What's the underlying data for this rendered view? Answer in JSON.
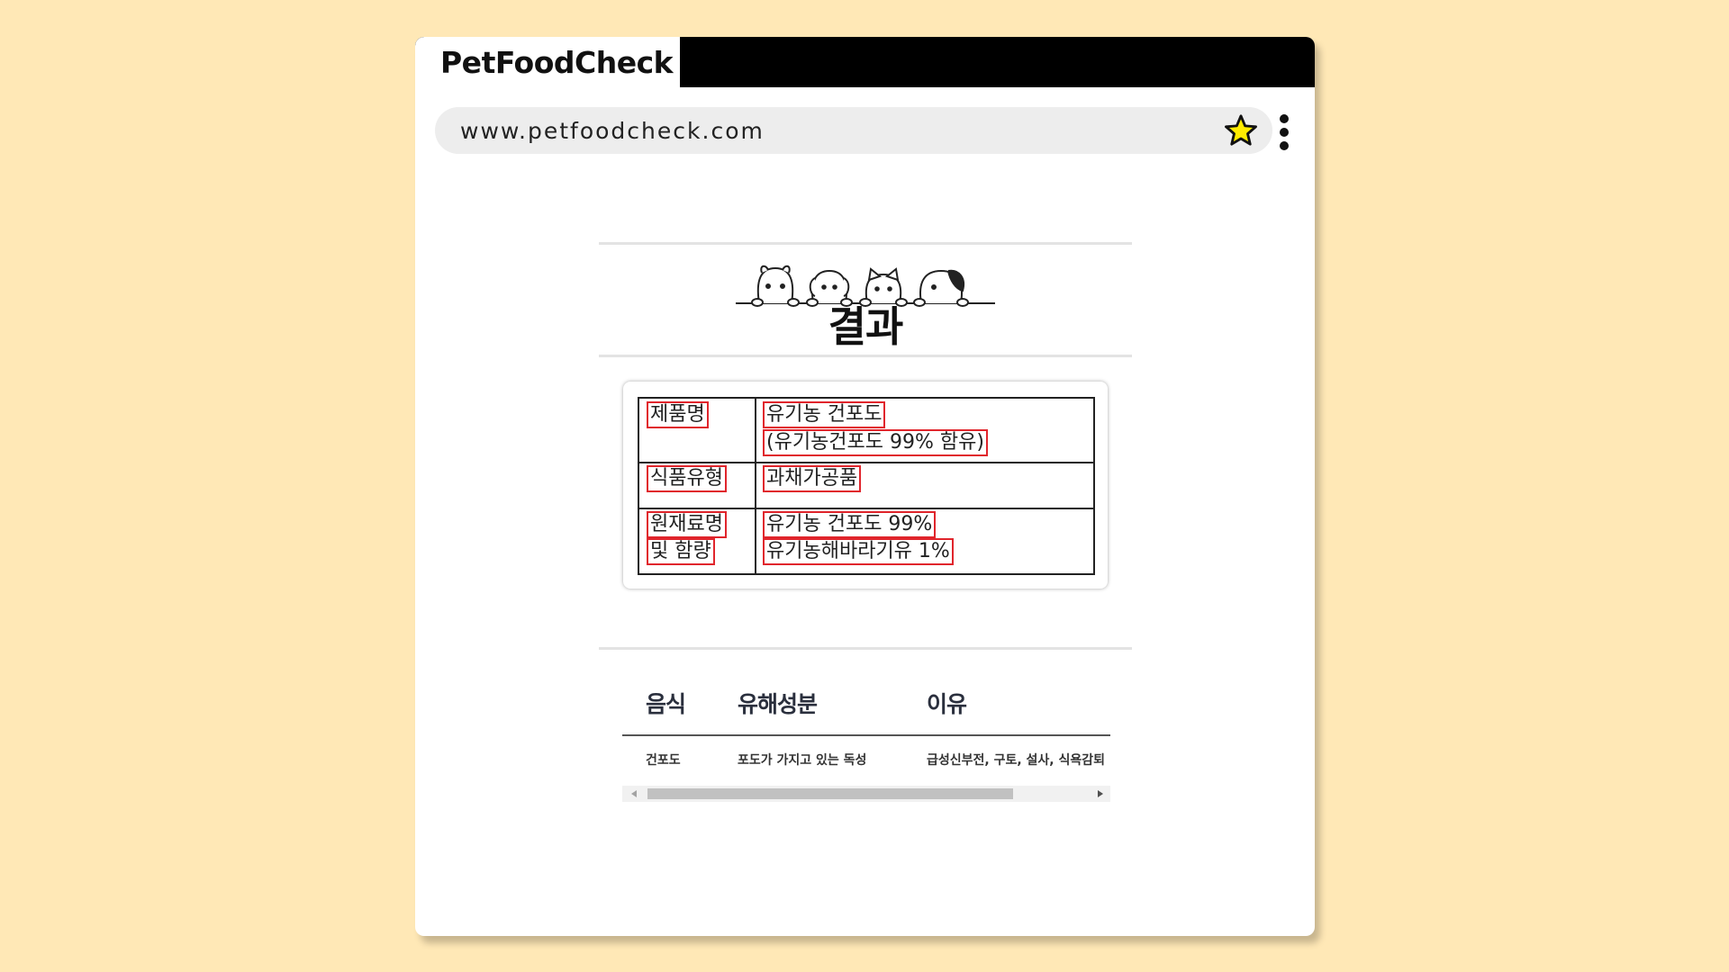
{
  "browser": {
    "tab_title": "PetFoodCheck",
    "url": "www.petfoodcheck.com",
    "bookmark_star_color": "#FFEB00"
  },
  "page": {
    "result_title": "결과",
    "label_table": {
      "rows": [
        {
          "label_lines": [
            "제품명"
          ],
          "value_lines": [
            "유기농 건포도",
            "(유기농건포도 99% 함유)"
          ]
        },
        {
          "label_lines": [
            "식품유형"
          ],
          "value_lines": [
            "과채가공품"
          ]
        },
        {
          "label_lines": [
            "원재료명",
            "및 함량"
          ],
          "value_lines": [
            "유기농 건포도 99%",
            "유기농해바라기유 1%"
          ]
        }
      ],
      "highlight_color": "#E0252C"
    },
    "harmful_table": {
      "headers": [
        "음식",
        "유해성분",
        "이유"
      ],
      "row": [
        "건포도",
        "포도가 가지고 있는 독성",
        "급성신부전, 구토, 설사, 식욕감퇴"
      ]
    }
  }
}
